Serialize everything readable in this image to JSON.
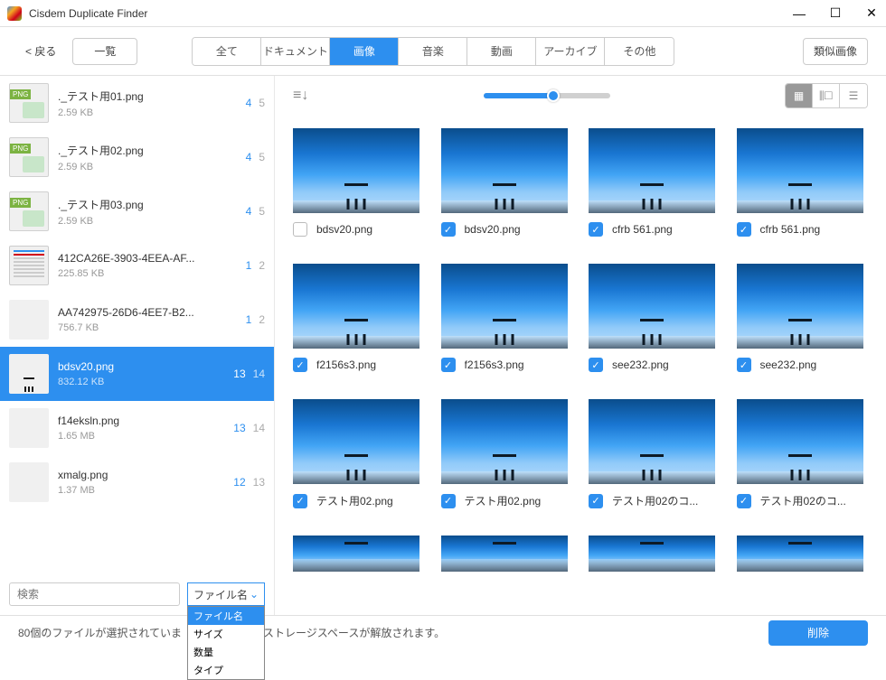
{
  "window": {
    "title": "Cisdem Duplicate Finder"
  },
  "toolbar": {
    "back": "< 戻る",
    "overview": "一覧",
    "tabs": [
      "全て",
      "ドキュメント",
      "画像",
      "音楽",
      "動画",
      "アーカイブ",
      "その他"
    ],
    "active_tab_index": 2,
    "similar": "類似画像"
  },
  "sidebar": {
    "items": [
      {
        "name": "._テスト用01.png",
        "size": "2.59 KB",
        "c1": "4",
        "c2": "5",
        "thumb": "png"
      },
      {
        "name": "._テスト用02.png",
        "size": "2.59 KB",
        "c1": "4",
        "c2": "5",
        "thumb": "png"
      },
      {
        "name": "._テスト用03.png",
        "size": "2.59 KB",
        "c1": "4",
        "c2": "5",
        "thumb": "png"
      },
      {
        "name": "412CA26E-3903-4EEA-AF...",
        "size": "225.85 KB",
        "c1": "1",
        "c2": "2",
        "thumb": "doc"
      },
      {
        "name": "AA742975-26D6-4EE7-B2...",
        "size": "756.7 KB",
        "c1": "1",
        "c2": "2",
        "thumb": "blue"
      },
      {
        "name": "bdsv20.png",
        "size": "832.12 KB",
        "c1": "13",
        "c2": "14",
        "thumb": "sky",
        "selected": true
      },
      {
        "name": "f14eksln.png",
        "size": "1.65 MB",
        "c1": "13",
        "c2": "14",
        "thumb": "pink"
      },
      {
        "name": "xmalg.png",
        "size": "1.37 MB",
        "c1": "12",
        "c2": "13",
        "thumb": "temple"
      }
    ],
    "search_placeholder": "検索",
    "sort_label": "ファイル名",
    "sort_options": [
      "ファイル名",
      "サイズ",
      "数量",
      "タイプ"
    ]
  },
  "grid": {
    "cells": [
      {
        "name": "bdsv20.png",
        "checked": false
      },
      {
        "name": "bdsv20.png",
        "checked": true
      },
      {
        "name": "cfrb 561.png",
        "checked": true
      },
      {
        "name": "cfrb 561.png",
        "checked": true
      },
      {
        "name": "f2156s3.png",
        "checked": true
      },
      {
        "name": "f2156s3.png",
        "checked": true
      },
      {
        "name": "see232.png",
        "checked": true
      },
      {
        "name": "see232.png",
        "checked": true
      },
      {
        "name": "テスト用02.png",
        "checked": true
      },
      {
        "name": "テスト用02.png",
        "checked": true
      },
      {
        "name": "テスト用02のコ...",
        "checked": true
      },
      {
        "name": "テスト用02のコ...",
        "checked": true
      }
    ]
  },
  "status": {
    "count": "80",
    "text_prefix": " 個のファイルが選択されていま",
    "text_suffix": "ストレージスペースが解放されます。",
    "delete": "削除"
  }
}
